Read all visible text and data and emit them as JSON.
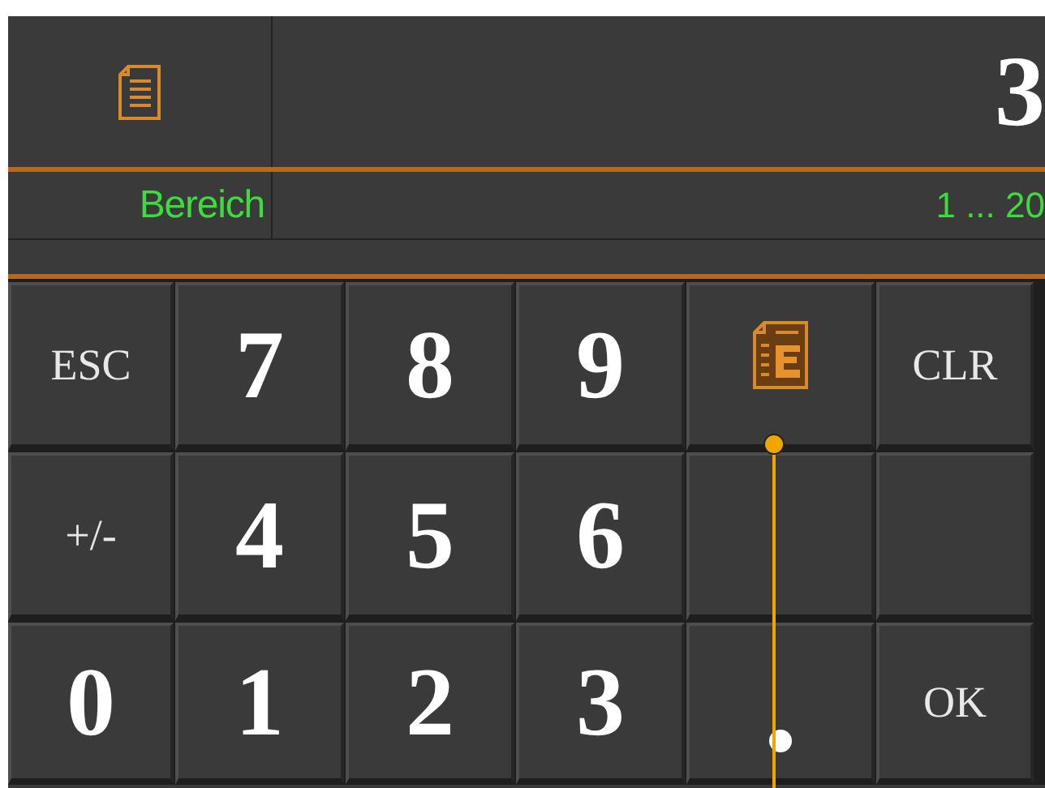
{
  "display": {
    "value": "3"
  },
  "range": {
    "label": "Bereich",
    "value": "1 ... 20"
  },
  "keys": [
    {
      "kind": "text",
      "label": "ESC"
    },
    {
      "kind": "digit",
      "label": "7"
    },
    {
      "kind": "digit",
      "label": "8"
    },
    {
      "kind": "digit",
      "label": "9"
    },
    {
      "kind": "icon"
    },
    {
      "kind": "text",
      "label": "CLR"
    },
    {
      "kind": "text",
      "label": "+/-"
    },
    {
      "kind": "digit",
      "label": "4"
    },
    {
      "kind": "digit",
      "label": "5"
    },
    {
      "kind": "digit",
      "label": "6"
    },
    {
      "kind": "empty"
    },
    {
      "kind": "empty"
    },
    {
      "kind": "digit",
      "label": "0"
    },
    {
      "kind": "digit",
      "label": "1"
    },
    {
      "kind": "digit",
      "label": "2"
    },
    {
      "kind": "digit",
      "label": "3"
    },
    {
      "kind": "dot"
    },
    {
      "kind": "text",
      "label": "OK"
    }
  ]
}
